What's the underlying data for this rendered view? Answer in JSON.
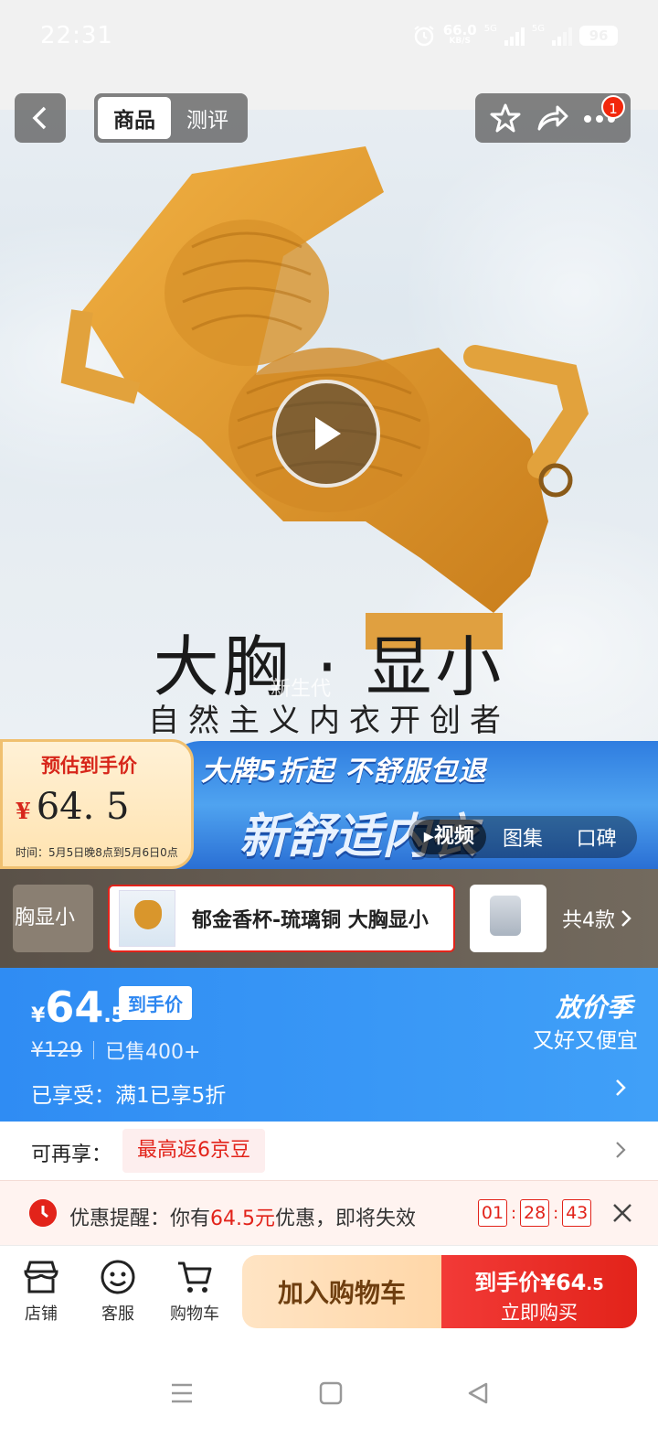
{
  "status_bar": {
    "time": "22:31",
    "net_speed": "66.0",
    "net_unit": "KB/S",
    "sim1_label": "5G",
    "sim2_label": "5G",
    "battery": "96"
  },
  "nav": {
    "tabs": [
      {
        "label": "商品",
        "active": true
      },
      {
        "label": "测评",
        "active": false
      }
    ],
    "cart_badge": "1"
  },
  "hero": {
    "headline": "大胸 · 显小",
    "watermark": "新生代",
    "subline": "自然主义内衣开创者"
  },
  "promo": {
    "est_title": "预估到手价",
    "est_currency": "¥",
    "est_price": "64. 5",
    "est_time": "时间：5月5日晚8点到5月6日0点",
    "slogan": "大牌5折起 不舒服包退",
    "big_text": "新舒适内衣",
    "media_tabs": [
      "视频",
      "图集",
      "口碑"
    ]
  },
  "sku": {
    "prev_label": "胸显小",
    "active_name": "郁金香杯-琉璃铜 大胸显小",
    "count_label": "共4款"
  },
  "price": {
    "currency": "¥",
    "integer": "64",
    "decimal": ".5",
    "tag": "到手价",
    "original": "¥129",
    "sold": "已售400+",
    "season_title": "放价季",
    "season_sub": "又好又便宜",
    "discount": "已享受：满1已享5折"
  },
  "bean": {
    "label": "可再享：",
    "chip": "最高返6京豆"
  },
  "reminder": {
    "prefix": "优惠提醒：你有",
    "amount": "64.5元",
    "suffix": "优惠，即将失效",
    "countdown": [
      "01",
      "28",
      "43"
    ]
  },
  "actions": {
    "store": "店铺",
    "service": "客服",
    "cart": "购物车",
    "add_cart": "加入购物车",
    "buy_price_prefix": "到手价¥64",
    "buy_price_decimal": ".5",
    "buy_now": "立即购买"
  },
  "colors": {
    "accent_red": "#e2231a",
    "price_blue": "#2f8cf3",
    "cart_gold": "#ffd7a8"
  }
}
